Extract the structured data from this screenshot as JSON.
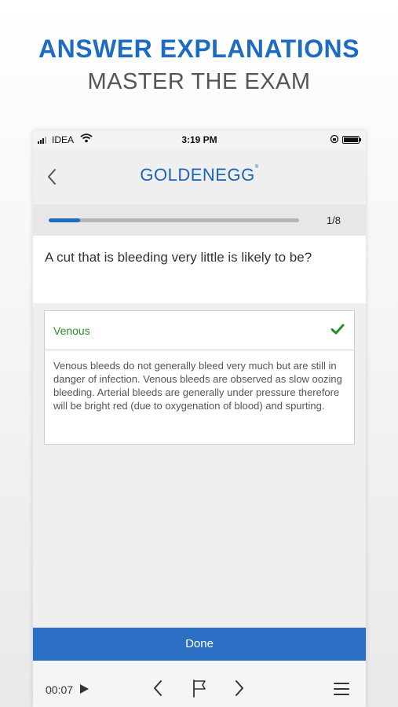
{
  "promo": {
    "headline": "ANSWER EXPLANATIONS",
    "subline": "MASTER THE EXAM"
  },
  "status_bar": {
    "carrier": "IDEA",
    "time": "3:19 PM"
  },
  "nav": {
    "brand": "GOLDENEGG"
  },
  "progress": {
    "label": "1/8",
    "fraction": 0.125
  },
  "question": {
    "text": "A cut that is bleeding very little is likely to be?"
  },
  "answer": {
    "label": "Venous",
    "explanation": "Venous bleeds do not generally bleed very much but are still in danger of infection. Venous bleeds are observed as slow oozing bleeding. Arterial bleeds are generally under pressure therefore will be bright red (due to oxygenation of blood) and spurting."
  },
  "actions": {
    "done_label": "Done"
  },
  "toolbar": {
    "timer": "00:07"
  },
  "colors": {
    "accent": "#1e6cc1",
    "correct": "#2a8a2a",
    "done_button": "#2c70c6"
  }
}
